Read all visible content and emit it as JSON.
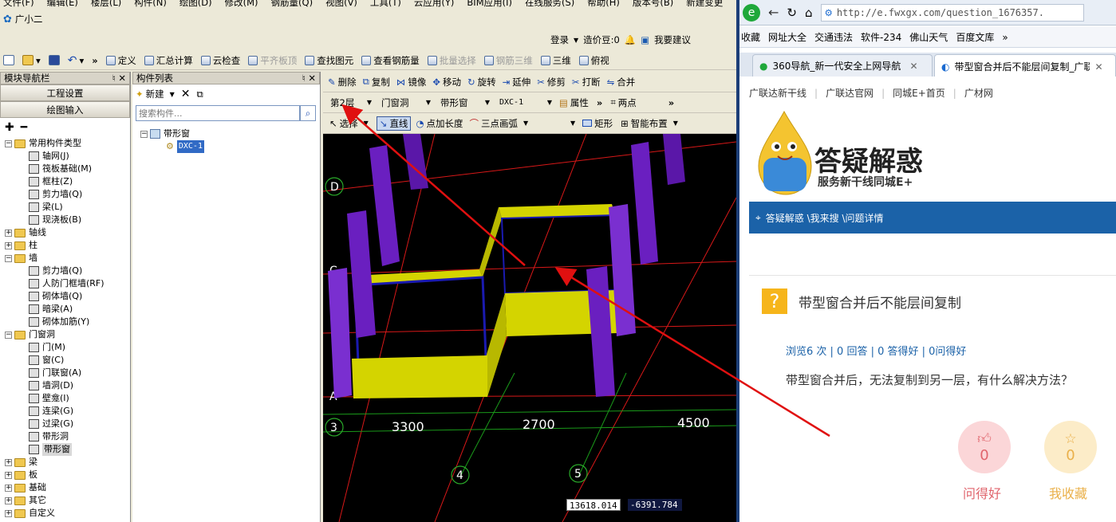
{
  "menu": [
    "文件(F)",
    "编辑(E)",
    "楼层(L)",
    "构件(N)",
    "绘图(D)",
    "修改(M)",
    "钢筋量(Q)",
    "视图(V)",
    "工具(T)",
    "云应用(Y)",
    "BIM应用(I)",
    "在线服务(S)",
    "帮助(H)",
    "版本号(B)",
    "新建变更"
  ],
  "user": {
    "name": "广小二",
    "login": "登录",
    "price": "造价豆:0",
    "suggest": "我要建议"
  },
  "toolbar_main": [
    {
      "label": "定义",
      "disabled": false
    },
    {
      "label": "汇总计算",
      "disabled": false
    },
    {
      "label": "云检查",
      "disabled": false
    },
    {
      "label": "平齐板顶",
      "disabled": true
    },
    {
      "label": "查找图元",
      "disabled": false
    },
    {
      "label": "查看钢筋量",
      "disabled": false
    },
    {
      "label": "批量选择",
      "disabled": true
    },
    {
      "label": "钢筋三维",
      "disabled": true
    },
    {
      "label": "三维",
      "disabled": false
    },
    {
      "label": "俯视",
      "disabled": false
    }
  ],
  "nav": {
    "title": "模块导航栏",
    "buttons": [
      "工程设置",
      "绘图输入"
    ],
    "tree": [
      {
        "label": "常用构件类型",
        "level": 0,
        "type": "folder",
        "open": true
      },
      {
        "label": "轴网(J)",
        "level": 1,
        "type": "item"
      },
      {
        "label": "筏板基础(M)",
        "level": 1,
        "type": "item"
      },
      {
        "label": "框柱(Z)",
        "level": 1,
        "type": "item"
      },
      {
        "label": "剪力墙(Q)",
        "level": 1,
        "type": "item"
      },
      {
        "label": "梁(L)",
        "level": 1,
        "type": "item"
      },
      {
        "label": "现浇板(B)",
        "level": 1,
        "type": "item"
      },
      {
        "label": "轴线",
        "level": 0,
        "type": "folder",
        "open": false
      },
      {
        "label": "柱",
        "level": 0,
        "type": "folder",
        "open": false
      },
      {
        "label": "墙",
        "level": 0,
        "type": "folder",
        "open": true
      },
      {
        "label": "剪力墙(Q)",
        "level": 1,
        "type": "item"
      },
      {
        "label": "人防门框墙(RF)",
        "level": 1,
        "type": "item"
      },
      {
        "label": "砌体墙(Q)",
        "level": 1,
        "type": "item"
      },
      {
        "label": "暗梁(A)",
        "level": 1,
        "type": "item"
      },
      {
        "label": "砌体加筋(Y)",
        "level": 1,
        "type": "item"
      },
      {
        "label": "门窗洞",
        "level": 0,
        "type": "folder",
        "open": true
      },
      {
        "label": "门(M)",
        "level": 1,
        "type": "item"
      },
      {
        "label": "窗(C)",
        "level": 1,
        "type": "item"
      },
      {
        "label": "门联窗(A)",
        "level": 1,
        "type": "item"
      },
      {
        "label": "墙洞(D)",
        "level": 1,
        "type": "item"
      },
      {
        "label": "壁龛(I)",
        "level": 1,
        "type": "item"
      },
      {
        "label": "连梁(G)",
        "level": 1,
        "type": "item"
      },
      {
        "label": "过梁(G)",
        "level": 1,
        "type": "item"
      },
      {
        "label": "带形洞",
        "level": 1,
        "type": "item"
      },
      {
        "label": "带形窗",
        "level": 1,
        "type": "item",
        "selected": true
      },
      {
        "label": "梁",
        "level": 0,
        "type": "folder",
        "open": false
      },
      {
        "label": "板",
        "level": 0,
        "type": "folder",
        "open": false
      },
      {
        "label": "基础",
        "level": 0,
        "type": "folder",
        "open": false
      },
      {
        "label": "其它",
        "level": 0,
        "type": "folder",
        "open": false
      },
      {
        "label": "自定义",
        "level": 0,
        "type": "folder",
        "open": false
      }
    ]
  },
  "components": {
    "title": "构件列表",
    "new_label": "新建",
    "search_placeholder": "搜索构件...",
    "group": "带形窗",
    "item": "DXC-1"
  },
  "edit_tb": [
    "删除",
    "复制",
    "镜像",
    "移动",
    "旋转",
    "延伸",
    "修剪",
    "打断",
    "合并"
  ],
  "layer_tb": {
    "floor": "第2层",
    "category": "门窗洞",
    "type": "带形窗",
    "component": "DXC-1",
    "attr": "属性",
    "twopoint": "两点"
  },
  "draw_tb": {
    "select": "选择",
    "line": "直线",
    "point_len": "点加长度",
    "arc": "三点画弧",
    "rect": "矩形",
    "smart": "智能布置"
  },
  "view": {
    "axis_labels": [
      "D",
      "C",
      "A",
      "3",
      "4",
      "5"
    ],
    "dims": [
      "3300",
      "2700",
      "4500"
    ],
    "coord_x": "13618.014",
    "coord_y": "-6391.784"
  },
  "browser": {
    "url": "http://e.fwxgx.com/question_1676357.",
    "favs": [
      "收藏",
      "网址大全",
      "交通违法",
      "软件-234",
      "佛山天气",
      "百度文库"
    ],
    "tabs": [
      "360导航_新一代安全上网导航",
      "带型窗合并后不能层间复制_广联"
    ],
    "site_links": [
      "广联达新干线",
      "广联达官网",
      "同城E+首页",
      "广材网"
    ],
    "brand_title": "答疑解惑",
    "brand_sub": "服务新干线同城E+",
    "breadcrumb": "答疑解惑 \\我来搜 \\问题详情",
    "question_title": "带型窗合并后不能层间复制",
    "stats": "浏览6 次 | 0 回答 | 0 答得好 | 0问得好",
    "question_body": "带型窗合并后，无法复制到另一层，有什么解决方法？",
    "good": {
      "count": "0",
      "label": "问得好"
    },
    "fav": {
      "count": "0",
      "label": "我收藏"
    }
  },
  "colors": {
    "pillar": "#6a1fc0",
    "beam": "#d4d400",
    "annotation": "#e01010",
    "breadcrumb_bg": "#1b62a8"
  }
}
